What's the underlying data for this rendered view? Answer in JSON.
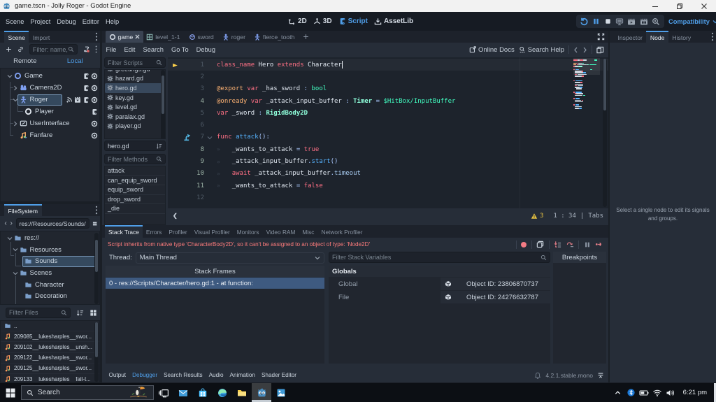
{
  "titlebar": {
    "title": "game.tscn - Jolly Roger - Godot Engine"
  },
  "menubar": {
    "items": [
      "Scene",
      "Project",
      "Debug",
      "Editor",
      "Help"
    ],
    "workspaces": [
      "2D",
      "3D",
      "Script",
      "AssetLib"
    ],
    "compatibility": "Compatibility"
  },
  "scene_dock": {
    "tabs": [
      "Scene",
      "Import"
    ],
    "filter_placeholder": "Filter: name,",
    "remote": "Remote",
    "local": "Local",
    "tree": [
      {
        "name": "Game",
        "icon": "node2d",
        "depth": 0,
        "chevron": "down",
        "trailing": [
          "script",
          "eye"
        ],
        "selected": false
      },
      {
        "name": "Camera2D",
        "icon": "camera",
        "depth": 1,
        "chevron": "right",
        "trailing": [
          "script",
          "eye"
        ],
        "selected": false
      },
      {
        "name": "Roger",
        "icon": "character",
        "depth": 1,
        "chevron": "down",
        "trailing": [
          "signal",
          "group",
          "script",
          "eye"
        ],
        "selected": true
      },
      {
        "name": "Player",
        "icon": "node",
        "depth": 2,
        "chevron": "none",
        "trailing": [
          "script"
        ],
        "selected": false
      },
      {
        "name": "UserInterface",
        "icon": "control",
        "depth": 1,
        "chevron": "right",
        "trailing": [
          "eye"
        ],
        "selected": false
      },
      {
        "name": "Fanfare",
        "icon": "audio",
        "depth": 1,
        "chevron": "none",
        "trailing": [
          "eye"
        ],
        "selected": false
      }
    ]
  },
  "filesystem": {
    "title": "FileSystem",
    "path": "res://Resources/Sounds/",
    "tree": [
      {
        "name": "res://",
        "depth": 0,
        "chevron": "down",
        "selected": false
      },
      {
        "name": "Resources",
        "depth": 1,
        "chevron": "down",
        "selected": false
      },
      {
        "name": "Sounds",
        "depth": 2,
        "chevron": "none",
        "selected": true
      },
      {
        "name": "Scenes",
        "depth": 1,
        "chevron": "down",
        "selected": false
      },
      {
        "name": "Character",
        "depth": 2,
        "chevron": "none",
        "selected": false
      },
      {
        "name": "Decoration",
        "depth": 2,
        "chevron": "none",
        "selected": false
      }
    ],
    "filter_placeholder": "Filter Files",
    "files": [
      {
        "name": "..",
        "icon": "folder"
      },
      {
        "name": "209085__lukesharples__swor...",
        "icon": "audio"
      },
      {
        "name": "209102__lukesharples__unsh...",
        "icon": "audio"
      },
      {
        "name": "209122__lukesharples__swor...",
        "icon": "audio"
      },
      {
        "name": "209125__lukesharples__swor...",
        "icon": "audio"
      },
      {
        "name": "209133__lukesharples__fall-t...",
        "icon": "audio"
      }
    ]
  },
  "scene_tabs": [
    {
      "label": "game",
      "icon": "ring",
      "active": true
    },
    {
      "label": "level_1-1",
      "icon": "tilemap",
      "active": false
    },
    {
      "label": "sword",
      "icon": "rigidbody",
      "active": false
    },
    {
      "label": "roger",
      "icon": "character",
      "active": false
    },
    {
      "label": "fierce_tooth",
      "icon": "character",
      "active": false
    }
  ],
  "script_editor": {
    "menus": [
      "File",
      "Edit",
      "Search",
      "Go To",
      "Debug"
    ],
    "online_docs": "Online Docs",
    "search_help": "Search Help",
    "filter_scripts_placeholder": "Filter Scripts",
    "scripts": [
      {
        "name": "greetings.gd",
        "selected": false
      },
      {
        "name": "hazard.gd",
        "selected": false
      },
      {
        "name": "hero.gd",
        "selected": true
      },
      {
        "name": "key.gd",
        "selected": false
      },
      {
        "name": "level.gd",
        "selected": false
      },
      {
        "name": "paralax.gd",
        "selected": false
      },
      {
        "name": "player.gd",
        "selected": false
      }
    ],
    "current_script": "hero.gd",
    "filter_methods_placeholder": "Filter Methods",
    "methods": [
      "attack",
      "can_equip_sword",
      "equip_sword",
      "drop_sword",
      "_die"
    ],
    "status": {
      "warnings": "3",
      "caret": "1 : 34",
      "indent": "Tabs",
      "collapse_arrow": "❮"
    }
  },
  "code": {
    "indent_glyph": "»",
    "lines": [
      {
        "n": "1",
        "marker": "exec",
        "tokens": [
          [
            "kw",
            "class_name"
          ],
          [
            "txt",
            " Hero "
          ],
          [
            "kw",
            "extends"
          ],
          [
            "txt",
            " Character"
          ]
        ],
        "caret": true
      },
      {
        "n": "2",
        "tokens": []
      },
      {
        "n": "3",
        "tokens": [
          [
            "ann",
            "@export"
          ],
          [
            "txt",
            " "
          ],
          [
            "kw",
            "var"
          ],
          [
            "txt",
            " _has_sword "
          ],
          [
            "sym",
            ":"
          ],
          [
            "txt",
            " "
          ],
          [
            "base",
            "bool"
          ]
        ]
      },
      {
        "n": "4",
        "safe": true,
        "tokens": [
          [
            "ann",
            "@onready"
          ],
          [
            "txt",
            " "
          ],
          [
            "kw",
            "var"
          ],
          [
            "txt",
            " _attack_input_buffer "
          ],
          [
            "sym",
            ":"
          ],
          [
            "txt",
            " "
          ],
          [
            "etype",
            "Timer"
          ],
          [
            "txt",
            " "
          ],
          [
            "sym",
            "="
          ],
          [
            "txt",
            " "
          ],
          [
            "base",
            "$HitBox/InputBuffer"
          ]
        ]
      },
      {
        "n": "5",
        "tokens": [
          [
            "kw",
            "var"
          ],
          [
            "txt",
            " _sword "
          ],
          [
            "sym",
            ":"
          ],
          [
            "txt",
            " "
          ],
          [
            "etype",
            "RigidBody2D"
          ]
        ]
      },
      {
        "n": "6",
        "tokens": []
      },
      {
        "n": "7",
        "marker": "conn",
        "fold": true,
        "tokens": [
          [
            "kw",
            "func"
          ],
          [
            "txt",
            " "
          ],
          [
            "fn",
            "attack"
          ],
          [
            "sym",
            "():"
          ]
        ]
      },
      {
        "n": "8",
        "safe": true,
        "indent": 1,
        "tokens": [
          [
            "txt",
            "_wants_to_attack "
          ],
          [
            "sym",
            "="
          ],
          [
            "txt",
            " "
          ],
          [
            "kw",
            "true"
          ]
        ]
      },
      {
        "n": "9",
        "safe": true,
        "indent": 1,
        "tokens": [
          [
            "txt",
            "_attack_input_buffer"
          ],
          [
            "sym",
            "."
          ],
          [
            "fn",
            "start"
          ],
          [
            "sym",
            "()"
          ]
        ]
      },
      {
        "n": "10",
        "safe": true,
        "indent": 1,
        "tokens": [
          [
            "kw",
            "await"
          ],
          [
            "txt",
            " _attack_input_buffer"
          ],
          [
            "sym",
            "."
          ],
          [
            "mem",
            "timeout"
          ]
        ]
      },
      {
        "n": "11",
        "safe": true,
        "indent": 1,
        "tokens": [
          [
            "txt",
            "_wants_to_attack "
          ],
          [
            "sym",
            "="
          ],
          [
            "txt",
            " "
          ],
          [
            "kw",
            "false"
          ]
        ]
      },
      {
        "n": "12",
        "tokens": []
      }
    ]
  },
  "minimap": {
    "rows": [
      [
        0,
        [
          [
            "kw",
            10
          ],
          [
            "txt",
            5
          ],
          [
            "kw",
            8
          ],
          [
            "txt",
            9
          ],
          [
            "gap",
            18
          ],
          [
            "base",
            7
          ]
        ]
      ],
      [
        2,
        [
          [
            "ann",
            7
          ],
          [
            "kw",
            3
          ],
          [
            "txt",
            11
          ],
          [
            "base",
            4
          ]
        ]
      ],
      [
        3,
        [
          [
            "ann",
            8
          ],
          [
            "kw",
            3
          ],
          [
            "txt",
            21
          ],
          [
            "etype",
            5
          ],
          [
            "base",
            19
          ]
        ]
      ],
      [
        4,
        [
          [
            "kw",
            3
          ],
          [
            "txt",
            8
          ],
          [
            "etype",
            11
          ]
        ]
      ],
      [
        6,
        [
          [
            "kw",
            4
          ],
          [
            "fn",
            9
          ],
          [
            "gap",
            28
          ],
          [
            "base",
            6
          ]
        ]
      ],
      [
        7,
        [
          [
            "txt",
            17
          ],
          [
            "kw",
            4
          ]
        ],
        4
      ],
      [
        8,
        [
          [
            "txt",
            21
          ],
          [
            "fn",
            6
          ]
        ],
        4
      ],
      [
        9,
        [
          [
            "kw",
            5
          ],
          [
            "txt",
            24
          ]
        ],
        4
      ],
      [
        10,
        [
          [
            "txt",
            17
          ],
          [
            "kw",
            5
          ]
        ],
        4
      ],
      [
        13,
        [
          [
            "kw",
            4
          ],
          [
            "fn",
            18
          ]
        ]
      ],
      [
        14,
        [
          [
            "txt",
            14
          ],
          [
            "kw",
            4
          ]
        ],
        4
      ],
      [
        15,
        [
          [
            "txt",
            22
          ]
        ],
        4
      ],
      [
        16,
        [
          [
            "kw",
            5
          ],
          [
            "txt",
            16
          ]
        ],
        4
      ],
      [
        17,
        [
          [
            "txt",
            12
          ],
          [
            "fn",
            6
          ]
        ],
        4
      ],
      [
        18,
        [
          [
            "txt",
            14
          ]
        ],
        8
      ],
      [
        20,
        [
          [
            "kw",
            4
          ],
          [
            "fn",
            16
          ]
        ]
      ],
      [
        21,
        [
          [
            "kw",
            3
          ],
          [
            "txt",
            18
          ]
        ],
        4
      ],
      [
        22,
        [
          [
            "txt",
            20
          ],
          [
            "base",
            6
          ]
        ],
        4
      ],
      [
        24,
        [
          [
            "kw",
            4
          ],
          [
            "fn",
            12
          ]
        ]
      ],
      [
        25,
        [
          [
            "txt",
            16
          ],
          [
            "kw",
            4
          ]
        ],
        4
      ],
      [
        26,
        [
          [
            "txt",
            22
          ]
        ],
        4
      ],
      [
        28,
        [
          [
            "kw",
            4
          ],
          [
            "fn",
            9
          ]
        ]
      ],
      [
        29,
        [
          [
            "txt",
            18
          ]
        ],
        4
      ],
      [
        30,
        [
          [
            "txt",
            10
          ],
          [
            "fn",
            7
          ]
        ],
        4
      ]
    ]
  },
  "debugger": {
    "tabs": [
      "Stack Trace",
      "Errors",
      "Profiler",
      "Visual Profiler",
      "Monitors",
      "Video RAM",
      "Misc",
      "Network Profiler"
    ],
    "error": "Script inherits from native type 'CharacterBody2D', so it can't be assigned to an object of type: 'Node2D'",
    "thread_label": "Thread:",
    "thread_value": "Main Thread",
    "stack_frames_header": "Stack Frames",
    "frames": [
      "0 - res://Scripts/Character/hero.gd:1 - at function:"
    ],
    "filter_placeholder": "Filter Stack Variables",
    "globals_header": "Globals",
    "variables": [
      {
        "name": "Global",
        "value": "Object ID: 23806870737"
      },
      {
        "name": "File",
        "value": "Object ID: 24276632787"
      }
    ],
    "breakpoints_header": "Breakpoints"
  },
  "bottom_bar": {
    "items": [
      "Output",
      "Debugger",
      "Search Results",
      "Audio",
      "Animation",
      "Shader Editor"
    ],
    "active": "Debugger",
    "version": "4.2.1.stable.mono"
  },
  "right_dock": {
    "tabs": [
      "Inspector",
      "Node",
      "History"
    ],
    "active_tab": "Node",
    "message": "Select a single node to edit its signals and groups."
  },
  "taskbar": {
    "search_placeholder": "Search",
    "time": "6:21 pm"
  }
}
